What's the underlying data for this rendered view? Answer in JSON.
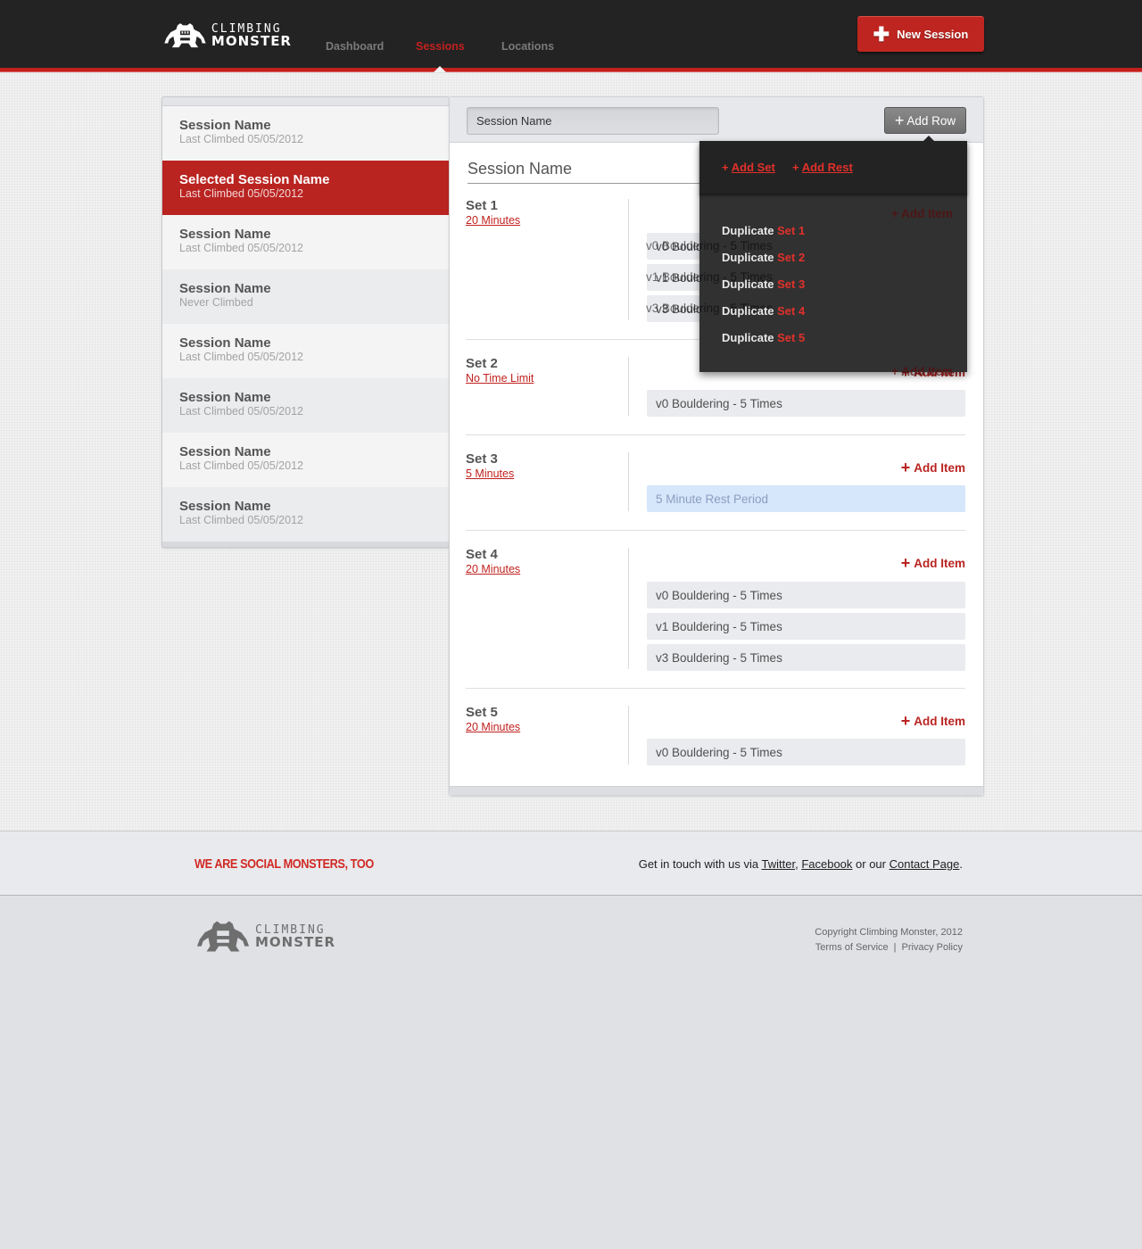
{
  "header": {
    "logo": {
      "line1": "CLIMBING",
      "line2": "MONSTER"
    },
    "nav": [
      {
        "label": "Dashboard",
        "active": false
      },
      {
        "label": "Sessions",
        "active": true
      },
      {
        "label": "Locations",
        "active": false
      }
    ],
    "new_session_label": "New Session"
  },
  "colors": {
    "accent": "#c0211e",
    "header_bg": "#232323",
    "rest_item_bg": "#d6e6fb"
  },
  "sidebar": {
    "sessions": [
      {
        "name": "Session Name",
        "sub": "Last Climbed 05/05/2012",
        "selected": false
      },
      {
        "name": "Selected Session Name",
        "sub": "Last Climbed 05/05/2012",
        "selected": true
      },
      {
        "name": "Session Name",
        "sub": "Last Climbed 05/05/2012",
        "selected": false
      },
      {
        "name": "Session Name",
        "sub": "Never Climbed",
        "selected": false
      },
      {
        "name": "Session Name",
        "sub": "Last Climbed 05/05/2012",
        "selected": false
      },
      {
        "name": "Session Name",
        "sub": "Last Climbed 05/05/2012",
        "selected": false
      },
      {
        "name": "Session Name",
        "sub": "Last Climbed 05/05/2012",
        "selected": false
      },
      {
        "name": "Session Name",
        "sub": "Last Climbed 05/05/2012",
        "selected": false
      }
    ]
  },
  "main": {
    "name_input_value": "Session Name",
    "add_row_label": "Add Row",
    "title": "Session Name",
    "add_item_label": "Add Item",
    "sets": [
      {
        "name": "Set 1",
        "duration": "20 Minutes",
        "items": [
          {
            "text": "v0 Bouldering - 5 Times",
            "type": "exercise"
          },
          {
            "text": "v1 Bouldering - 5 Times",
            "type": "exercise"
          },
          {
            "text": "v3 Bouldering - 5 Times",
            "type": "exercise"
          }
        ]
      },
      {
        "name": "Set 2",
        "duration": "No Time Limit",
        "items": [
          {
            "text": "v0 Bouldering - 5 Times",
            "type": "exercise"
          }
        ]
      },
      {
        "name": "Set 3",
        "duration": "5 Minutes",
        "items": [
          {
            "text": "5 Minute Rest Period",
            "type": "rest"
          }
        ]
      },
      {
        "name": "Set 4",
        "duration": "20 Minutes",
        "items": [
          {
            "text": "v0 Bouldering - 5 Times",
            "type": "exercise"
          },
          {
            "text": "v1 Bouldering - 5 Times",
            "type": "exercise"
          },
          {
            "text": "v3 Bouldering - 5 Times",
            "type": "exercise"
          }
        ]
      },
      {
        "name": "Set 5",
        "duration": "20 Minutes",
        "items": [
          {
            "text": "v0 Bouldering - 5 Times",
            "type": "exercise"
          }
        ]
      }
    ]
  },
  "dropdown": {
    "add_set_label": "Add Set",
    "add_rest_label": "Add Rest",
    "duplicate_prefix": "Duplicate",
    "duplicate_targets": [
      "Set 1",
      "Set 2",
      "Set 3",
      "Set 4",
      "Set 5"
    ]
  },
  "footer": {
    "social_title": "WE ARE SOCIAL MONSTERS, TOO",
    "social_prefix": "Get in touch with us via ",
    "twitter": "Twitter",
    "comma": ",",
    "facebook": "Facebook",
    "or_our": " or our ",
    "contact": "Contact Page",
    "period": ".",
    "copyright": "Copyright Climbing Monster, 2012",
    "terms": "Terms of Service",
    "divider": "|",
    "privacy": "Privacy Policy"
  }
}
